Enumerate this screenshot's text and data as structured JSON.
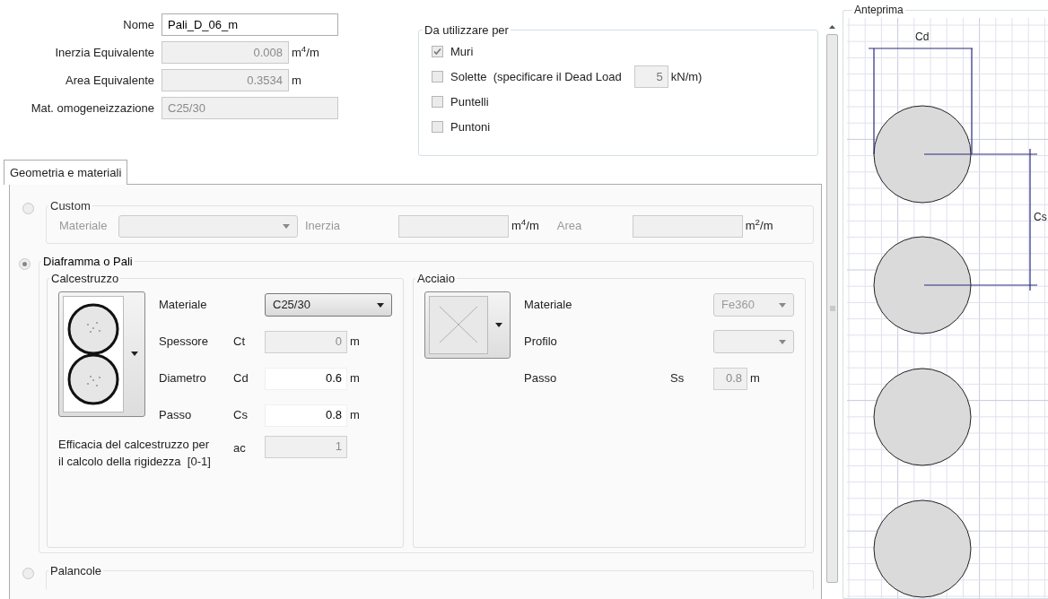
{
  "form": {
    "fields": [
      {
        "label": "Nome",
        "value": "Pali_D_06_m",
        "disabled": false
      },
      {
        "label": "Inerzia Equivalente",
        "value": "0.008",
        "unit": "m$^{4}$/m",
        "disabled": true
      },
      {
        "label": "Area Equivalente",
        "value": "0.3534",
        "unit": "m",
        "disabled": true
      },
      {
        "label": "Mat. omogeneizzazione",
        "value": "C25/30",
        "disabled": true
      }
    ]
  },
  "usage": {
    "title": "Da utilizzare per",
    "options": [
      {
        "label": "Muri",
        "checked": true
      },
      {
        "label": "Solette  (specificare il Dead Load",
        "checked": false,
        "value": "5",
        "unit": "kN/m)"
      },
      {
        "label": "Puntelli",
        "checked": false
      },
      {
        "label": "Puntoni",
        "checked": false
      }
    ]
  },
  "tabs": [
    {
      "label": "Geometria e materiali",
      "selected": true
    }
  ],
  "sections": [
    {
      "title": "Custom",
      "selected": false,
      "fields": [
        {
          "kind": "select",
          "label": "Materiale"
        },
        {
          "kind": "input",
          "label": "Inerzia",
          "unit": "m$^{4}$/m"
        },
        {
          "kind": "input",
          "label": "Area",
          "unit": "m$^{2}$/m"
        }
      ]
    },
    {
      "title": "Diaframma o Pali",
      "selected": true,
      "groups": [
        {
          "title": "Calcestruzzo",
          "picker": {
            "kind": "piles"
          },
          "rows": [
            {
              "kind": "select",
              "label": "Materiale",
              "value": "C25/30",
              "disabled": false
            },
            {
              "kind": "input",
              "label": "Spessore",
              "symbol": "Ct",
              "value": "0",
              "unit": "m",
              "disabled": true
            },
            {
              "kind": "input",
              "label": "Diametro",
              "symbol": "Cd",
              "value": "0.6",
              "unit": "m",
              "disabled": false
            },
            {
              "kind": "input",
              "label": "Passo",
              "symbol": "Cs",
              "value": "0.8",
              "unit": "m",
              "disabled": false
            },
            {
              "kind": "input",
              "label": "Efficacia del calcestruzzo per il calcolo della rigidezza  [0-1]",
              "symbol": "ac",
              "value": "1",
              "disabled": true
            }
          ]
        },
        {
          "title": "Acciaio",
          "picker": {
            "kind": "empty"
          },
          "rows": [
            {
              "kind": "select",
              "label": "Materiale",
              "value": "Fe360",
              "disabled": true
            },
            {
              "kind": "select",
              "label": "Profilo",
              "disabled": true
            },
            {
              "kind": "input",
              "label": "Passo",
              "symbol": "Ss",
              "value": "0.8",
              "unit": "m",
              "disabled": true
            }
          ]
        }
      ]
    },
    {
      "title": "Palancole",
      "selected": false
    }
  ],
  "preview": {
    "title": "Anteprima",
    "diameter_label": "Cd",
    "spacing_label": "Cs"
  }
}
